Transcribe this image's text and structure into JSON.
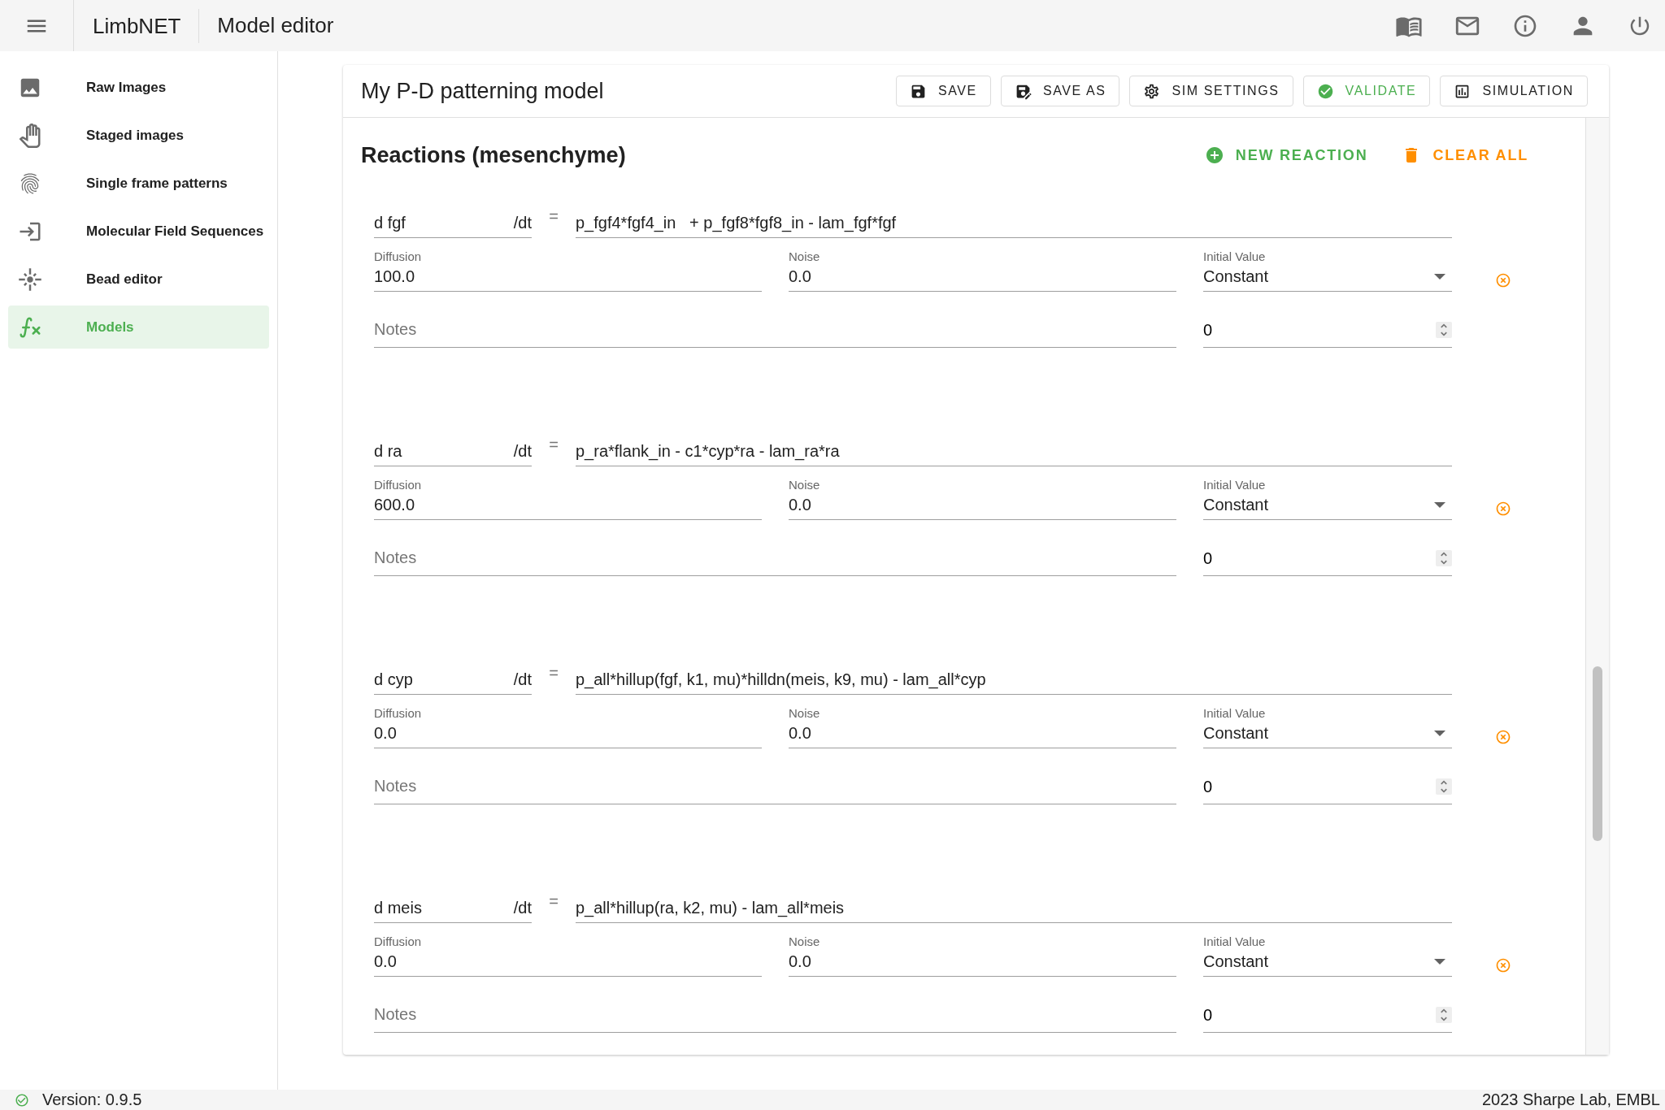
{
  "app": {
    "title": "LimbNET",
    "page_title": "Model editor"
  },
  "sidebar": {
    "items": [
      {
        "label": "Raw Images",
        "selected": false
      },
      {
        "label": "Staged images",
        "selected": false
      },
      {
        "label": "Single frame patterns",
        "selected": false
      },
      {
        "label": "Molecular Field Sequences",
        "selected": false
      },
      {
        "label": "Bead editor",
        "selected": false
      },
      {
        "label": "Models",
        "selected": true
      }
    ]
  },
  "model": {
    "name": "My P-D patterning model",
    "toolbar": [
      {
        "label": "SAVE",
        "kind": "default"
      },
      {
        "label": "SAVE AS",
        "kind": "default"
      },
      {
        "label": "SIM SETTINGS",
        "kind": "default"
      },
      {
        "label": "VALIDATE",
        "kind": "success"
      },
      {
        "label": "SIMULATION",
        "kind": "default"
      }
    ],
    "section": {
      "title": "Reactions (mesenchyme)",
      "actions": [
        {
          "label": "NEW REACTION",
          "color": "#4caf50"
        },
        {
          "label": "CLEAR ALL",
          "color": "#ff8f00"
        }
      ]
    },
    "reactions": [
      {
        "species": "d fgf",
        "suffix": "/dt",
        "equals": "=",
        "equation": "p_fgf4*fgf4_in   + p_fgf8*fgf8_in - lam_fgf*fgf",
        "diffusion_label": "Diffusion",
        "diffusion": "100.0",
        "noise_label": "Noise",
        "noise": "0.0",
        "initial_label": "Initial Value",
        "initial": "Constant",
        "notes_placeholder": "Notes",
        "count": "0"
      },
      {
        "species": "d ra",
        "suffix": "/dt",
        "equals": "=",
        "equation": "p_ra*flank_in - c1*cyp*ra - lam_ra*ra",
        "diffusion_label": "Diffusion",
        "diffusion": "600.0",
        "noise_label": "Noise",
        "noise": "0.0",
        "initial_label": "Initial Value",
        "initial": "Constant",
        "notes_placeholder": "Notes",
        "count": "0"
      },
      {
        "species": "d cyp",
        "suffix": "/dt",
        "equals": "=",
        "equation": "p_all*hillup(fgf, k1, mu)*hilldn(meis, k9, mu) - lam_all*cyp",
        "diffusion_label": "Diffusion",
        "diffusion": "0.0",
        "noise_label": "Noise",
        "noise": "0.0",
        "initial_label": "Initial Value",
        "initial": "Constant",
        "notes_placeholder": "Notes",
        "count": "0"
      },
      {
        "species": "d meis",
        "suffix": "/dt",
        "equals": "=",
        "equation": "p_all*hillup(ra, k2, mu) - lam_all*meis",
        "diffusion_label": "Diffusion",
        "diffusion": "0.0",
        "noise_label": "Noise",
        "noise": "0.0",
        "initial_label": "Initial Value",
        "initial": "Constant",
        "notes_placeholder": "Notes",
        "count": "0"
      }
    ]
  },
  "status_bar": {
    "version": "Version: 0.9.5",
    "credit": "2023 Sharpe Lab, EMBL"
  }
}
